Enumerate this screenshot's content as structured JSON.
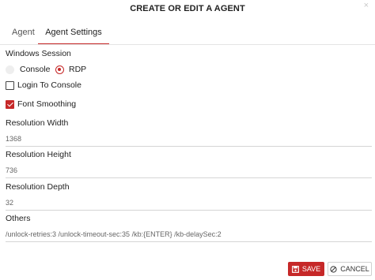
{
  "dialog": {
    "title": "CREATE OR EDIT A AGENT",
    "close_symbol": "×"
  },
  "tabs": [
    {
      "label": "Agent",
      "active": false
    },
    {
      "label": "Agent Settings",
      "active": true
    }
  ],
  "windows_session": {
    "label": "Windows Session",
    "options": [
      {
        "label": "Console",
        "selected": false
      },
      {
        "label": "RDP",
        "selected": true
      }
    ]
  },
  "login_to_console": {
    "label": "Login To Console",
    "checked": false
  },
  "font_smoothing": {
    "label": "Font Smoothing",
    "checked": true
  },
  "resolution_width": {
    "label": "Resolution Width",
    "value": "1368"
  },
  "resolution_height": {
    "label": "Resolution Height",
    "value": "736"
  },
  "resolution_depth": {
    "label": "Resolution Depth",
    "value": "32"
  },
  "others": {
    "label": "Others",
    "value": "/unlock-retries:3 /unlock-timeout-sec:35 /kb:{ENTER} /kb-delaySec:2"
  },
  "buttons": {
    "save": {
      "label": "SAVE",
      "icon": "save-icon"
    },
    "cancel": {
      "label": "CANCEL",
      "icon": "cancel-icon"
    }
  },
  "colors": {
    "accent": "#c62828"
  }
}
